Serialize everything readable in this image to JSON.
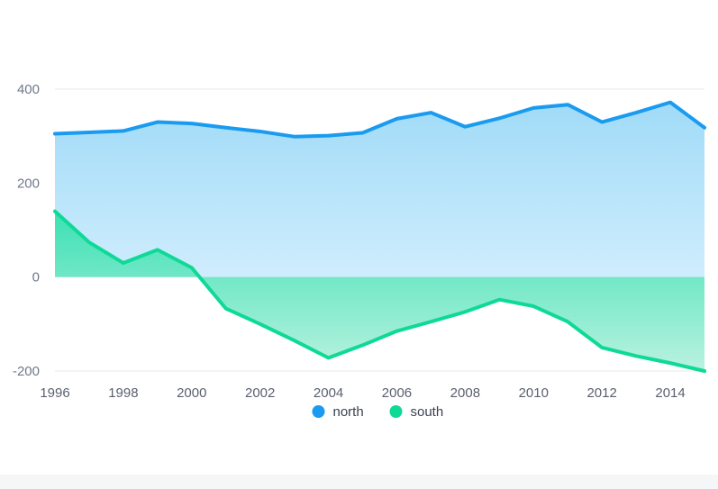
{
  "chart_data": {
    "type": "area",
    "title": "",
    "subtitle": "",
    "xlabel": "",
    "ylabel": "",
    "x": [
      1996,
      1997,
      1998,
      1999,
      2000,
      2001,
      2002,
      2003,
      2004,
      2005,
      2006,
      2007,
      2008,
      2009,
      2010,
      2011,
      2012,
      2013,
      2014,
      2015
    ],
    "xtick_labels": [
      "1996",
      "1998",
      "2000",
      "2002",
      "2004",
      "2006",
      "2008",
      "2010",
      "2012",
      "2014"
    ],
    "xtick_values": [
      1996,
      1998,
      2000,
      2002,
      2004,
      2006,
      2008,
      2010,
      2012,
      2014
    ],
    "ytick_labels": [
      "400",
      "200",
      "0",
      "-200"
    ],
    "ytick_values": [
      400,
      200,
      0,
      -200
    ],
    "xlim": [
      1996,
      2015
    ],
    "ylim": [
      -240,
      430
    ],
    "grid": true,
    "grid_axis": "y",
    "legend_position": "bottom",
    "stacked": false,
    "series": [
      {
        "name": "north",
        "color": "#1a9bf0",
        "fill_top_color": "#9bd9f7",
        "fill_bottom_color": "#bfe8fb",
        "values": [
          305,
          308,
          311,
          330,
          327,
          318,
          310,
          299,
          301,
          307,
          337,
          350,
          320,
          338,
          360,
          367,
          330,
          350,
          372,
          318
        ]
      },
      {
        "name": "south",
        "color": "#0fd997",
        "fill_top_color": "#2ee0b0",
        "fill_bottom_color": "#aef0dc",
        "values": [
          140,
          74,
          30,
          58,
          20,
          -67,
          -100,
          -135,
          -172,
          -145,
          -115,
          -95,
          -74,
          -48,
          -62,
          -95,
          -150,
          -168,
          -183,
          -200
        ]
      }
    ],
    "legend": [
      {
        "label": "north",
        "color": "#1a9bf0"
      },
      {
        "label": "south",
        "color": "#0fd997"
      }
    ],
    "colors": {
      "axis_text": "#70788c",
      "tick_text": "#5a6070",
      "gridline": "#e8e8e8",
      "background": "#ffffff",
      "footer_strip": "#f5f6f7"
    }
  }
}
